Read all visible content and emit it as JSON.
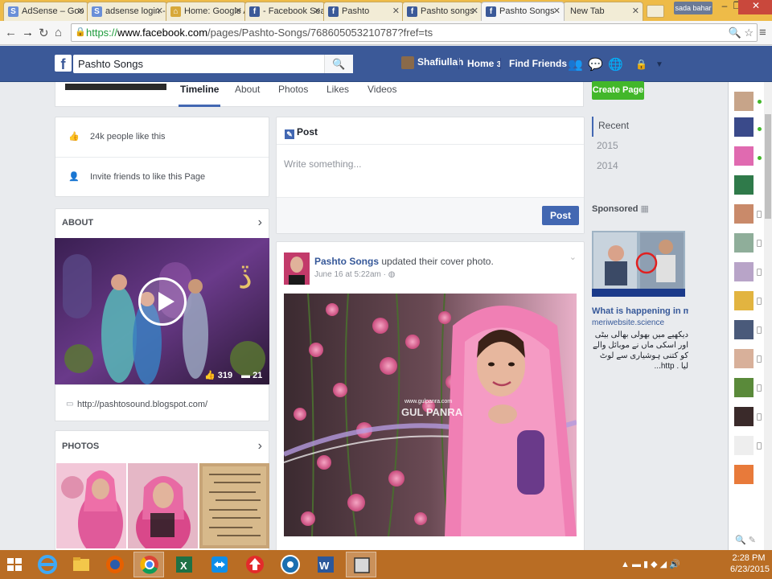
{
  "browser": {
    "tabs": [
      {
        "title": "AdSense – Goo",
        "icon": "google-g-icon"
      },
      {
        "title": "adsense login -",
        "icon": "google-g-icon"
      },
      {
        "title": "Home: Google A",
        "icon": "home-icon"
      },
      {
        "title": "- Facebook Sea",
        "icon": "facebook-icon"
      },
      {
        "title": "Pashto",
        "icon": "facebook-icon"
      },
      {
        "title": "Pashto songs",
        "icon": "facebook-icon"
      },
      {
        "title": "Pashto Songs",
        "icon": "facebook-icon",
        "active": true
      },
      {
        "title": "New Tab",
        "icon": "none"
      }
    ],
    "profile_name": "sada bahar",
    "url": {
      "scheme": "https://",
      "host": "www.facebook.com",
      "path": "/pages/Pashto-Songs/768605053210787?fref=ts"
    }
  },
  "fb_header": {
    "search_value": "Pashto Songs",
    "user_name": "Shafiullah",
    "home_label": "Home",
    "home_count": "3",
    "find_friends_label": "Find Friends"
  },
  "page_tabs": [
    "Timeline",
    "About",
    "Photos",
    "Likes",
    "Videos"
  ],
  "left": {
    "likes_count": "24k people like this",
    "invite_label": "Invite friends to like this Page",
    "about_title": "ABOUT",
    "video_likes": "319",
    "video_comments": "21",
    "website": "http://pashtosound.blogspot.com/",
    "photos_title": "PHOTOS"
  },
  "composer": {
    "tab_label": "Post",
    "placeholder": "Write something...",
    "post_button": "Post"
  },
  "story": {
    "page_name": "Pashto Songs",
    "action": "updated their cover photo.",
    "timestamp": "June 16 at 5:22am ·",
    "cover_watermark": "GUL PANRA",
    "cover_watermark_url": "www.gulpanra.com"
  },
  "right": {
    "create_page": "Create Page",
    "years": [
      "Recent",
      "2015",
      "2014"
    ],
    "sponsored": "Sponsored",
    "ad_title": "What is happening in mobil...",
    "ad_url": "meriwebsite.science",
    "ad_body": "دیکھیے میں بھولی بھالی بیٹی اور اسکی ماں نے موبائل والے کو کتنی ہوشیاری سے لوٹ لیا . http..."
  },
  "taskbar": {
    "time": "2:28 PM",
    "date": "6/23/2015"
  },
  "colors": {
    "fb_blue": "#3b5998",
    "link_blue": "#365899",
    "create_green": "#42b72a",
    "tab_strip": "#eebb48",
    "taskbar": "#b96d24"
  }
}
